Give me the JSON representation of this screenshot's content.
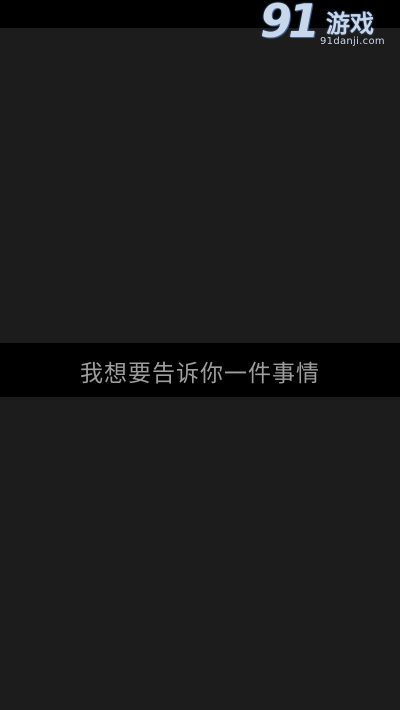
{
  "watermark": {
    "logo_number": "91",
    "logo_text": "游戏",
    "site": "91danji.com"
  },
  "dialogue": {
    "text": "我想要告诉你一件事情"
  }
}
